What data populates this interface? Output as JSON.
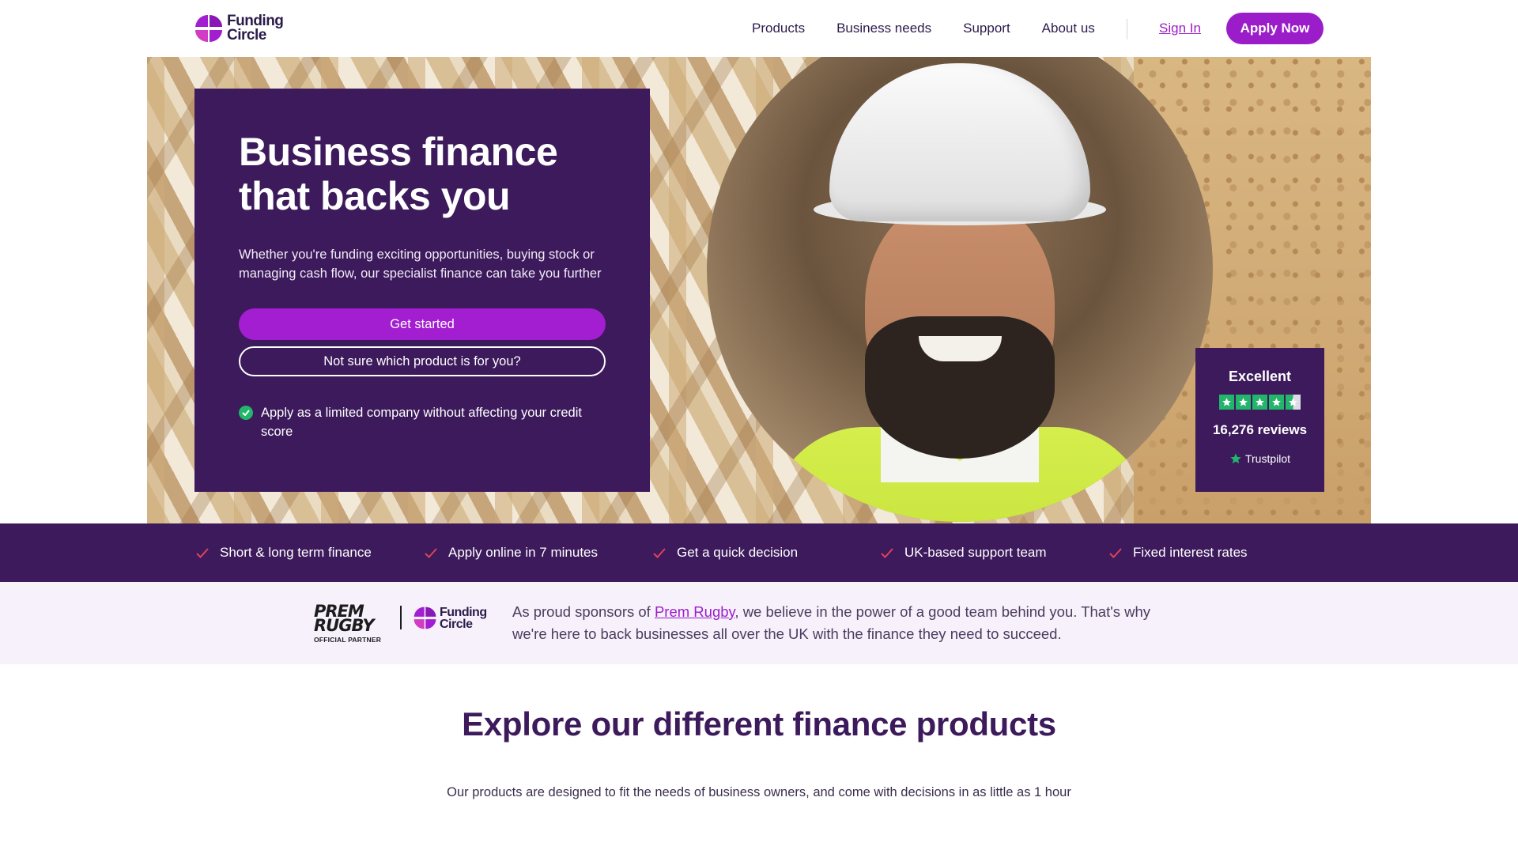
{
  "header": {
    "logo": {
      "line1": "Funding",
      "line2": "Circle"
    },
    "nav": [
      {
        "label": "Products"
      },
      {
        "label": "Business needs"
      },
      {
        "label": "Support"
      },
      {
        "label": "About us"
      }
    ],
    "sign_in": "Sign In",
    "apply_now": "Apply Now"
  },
  "hero": {
    "title": "Business finance that backs you",
    "subtitle": "Whether you're funding exciting opportunities, buying stock or managing cash flow, our specialist finance can take you further",
    "primary_cta": "Get started",
    "secondary_cta": "Not sure which product is for you?",
    "check_text": "Apply as a limited company without affecting your credit score"
  },
  "trustpilot": {
    "rating_label": "Excellent",
    "stars": 4.5,
    "reviews": "16,276 reviews",
    "brand": "Trustpilot"
  },
  "usps": [
    {
      "label": "Short & long term finance"
    },
    {
      "label": "Apply online in 7 minutes"
    },
    {
      "label": "Get a quick decision"
    },
    {
      "label": "UK-based support team"
    },
    {
      "label": "Fixed interest rates"
    }
  ],
  "sponsor": {
    "partner_logo_line1": "PREM",
    "partner_logo_line2": "RUGBY",
    "partner_caption": "OFFICIAL PARTNER",
    "fc_line1": "Funding",
    "fc_line2": "Circle",
    "text_before": "As proud sponsors of ",
    "link": "Prem Rugby",
    "text_after": ", we believe in the power of a good team behind you. That's why we're here to back businesses all over the UK with the finance they need to succeed."
  },
  "explore": {
    "title": "Explore our different finance products",
    "subtitle": "Our products are designed to fit the needs of business owners, and come with decisions in as little as 1 hour"
  },
  "colors": {
    "brand_purple": "#9b1dc9",
    "deep_purple": "#3c1a5b",
    "usp_check": "#e0425a",
    "trustpilot_green": "#22b56b",
    "sponsor_bg": "#f7f1fb"
  }
}
